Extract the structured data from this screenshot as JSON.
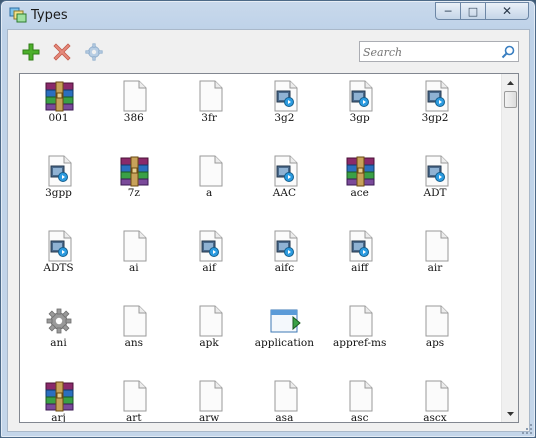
{
  "window": {
    "title": "Types",
    "minimize_glyph": "─",
    "maximize_glyph": "□",
    "close_glyph": "✕"
  },
  "toolbar": {
    "add_icon": "plus-icon",
    "delete_icon": "delete-x-icon",
    "settings_icon": "gear-icon",
    "search_placeholder": "Search"
  },
  "colors": {
    "add": "#4caf2a",
    "delete": "#e0705f",
    "settings_disabled": "#a9c3dd",
    "accent": "#3a7fc1"
  },
  "items": [
    {
      "label": "001",
      "icon": "archive"
    },
    {
      "label": "386",
      "icon": "file"
    },
    {
      "label": "3fr",
      "icon": "file"
    },
    {
      "label": "3g2",
      "icon": "media"
    },
    {
      "label": "3gp",
      "icon": "media"
    },
    {
      "label": "3gp2",
      "icon": "media"
    },
    {
      "label": "3gpp",
      "icon": "media"
    },
    {
      "label": "7z",
      "icon": "archive"
    },
    {
      "label": "a",
      "icon": "file"
    },
    {
      "label": "AAC",
      "icon": "media"
    },
    {
      "label": "ace",
      "icon": "archive"
    },
    {
      "label": "ADT",
      "icon": "media"
    },
    {
      "label": "ADTS",
      "icon": "media"
    },
    {
      "label": "ai",
      "icon": "file"
    },
    {
      "label": "aif",
      "icon": "media"
    },
    {
      "label": "aifc",
      "icon": "media"
    },
    {
      "label": "aiff",
      "icon": "media"
    },
    {
      "label": "air",
      "icon": "file"
    },
    {
      "label": "ani",
      "icon": "gear"
    },
    {
      "label": "ans",
      "icon": "file"
    },
    {
      "label": "apk",
      "icon": "file"
    },
    {
      "label": "application",
      "icon": "app"
    },
    {
      "label": "appref-ms",
      "icon": "file"
    },
    {
      "label": "aps",
      "icon": "file"
    },
    {
      "label": "arj",
      "icon": "archive"
    },
    {
      "label": "art",
      "icon": "file"
    },
    {
      "label": "arw",
      "icon": "file"
    },
    {
      "label": "asa",
      "icon": "file"
    },
    {
      "label": "asc",
      "icon": "file"
    },
    {
      "label": "ascx",
      "icon": "file"
    }
  ]
}
